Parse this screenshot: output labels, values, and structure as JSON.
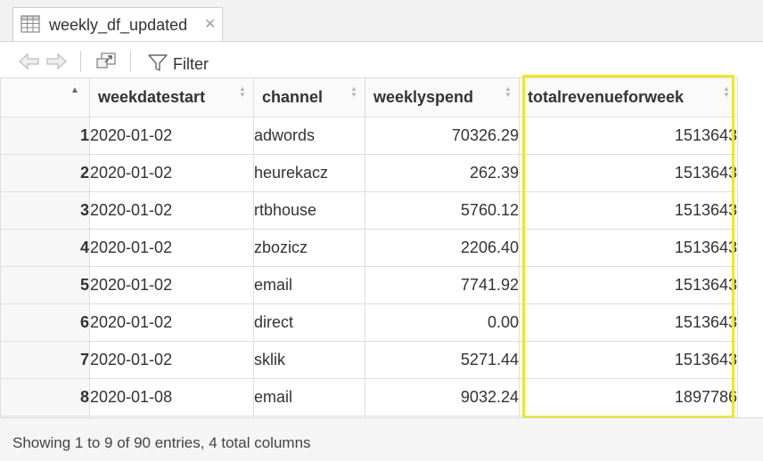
{
  "tab": {
    "title": "weekly_df_updated",
    "close": "✕"
  },
  "toolbar": {
    "filter_label": "Filter"
  },
  "table": {
    "columns": [
      "weekdatestart",
      "channel",
      "weeklyspend",
      "totalrevenueforweek"
    ],
    "rows": [
      {
        "n": "1",
        "weekdatestart": "2020-01-02",
        "channel": "adwords",
        "weeklyspend": "70326.29",
        "totalrevenueforweek": "1513643"
      },
      {
        "n": "2",
        "weekdatestart": "2020-01-02",
        "channel": "heurekacz",
        "weeklyspend": "262.39",
        "totalrevenueforweek": "1513643"
      },
      {
        "n": "3",
        "weekdatestart": "2020-01-02",
        "channel": "rtbhouse",
        "weeklyspend": "5760.12",
        "totalrevenueforweek": "1513643"
      },
      {
        "n": "4",
        "weekdatestart": "2020-01-02",
        "channel": "zbozicz",
        "weeklyspend": "2206.40",
        "totalrevenueforweek": "1513643"
      },
      {
        "n": "5",
        "weekdatestart": "2020-01-02",
        "channel": "email",
        "weeklyspend": "7741.92",
        "totalrevenueforweek": "1513643"
      },
      {
        "n": "6",
        "weekdatestart": "2020-01-02",
        "channel": "direct",
        "weeklyspend": "0.00",
        "totalrevenueforweek": "1513643"
      },
      {
        "n": "7",
        "weekdatestart": "2020-01-02",
        "channel": "sklik",
        "weeklyspend": "5271.44",
        "totalrevenueforweek": "1513643"
      },
      {
        "n": "8",
        "weekdatestart": "2020-01-08",
        "channel": "email",
        "weeklyspend": "9032.24",
        "totalrevenueforweek": "1897786"
      }
    ]
  },
  "footer": {
    "status": "Showing 1 to 9 of 90 entries, 4 total columns"
  },
  "colors": {
    "highlight": "#f2e626"
  }
}
